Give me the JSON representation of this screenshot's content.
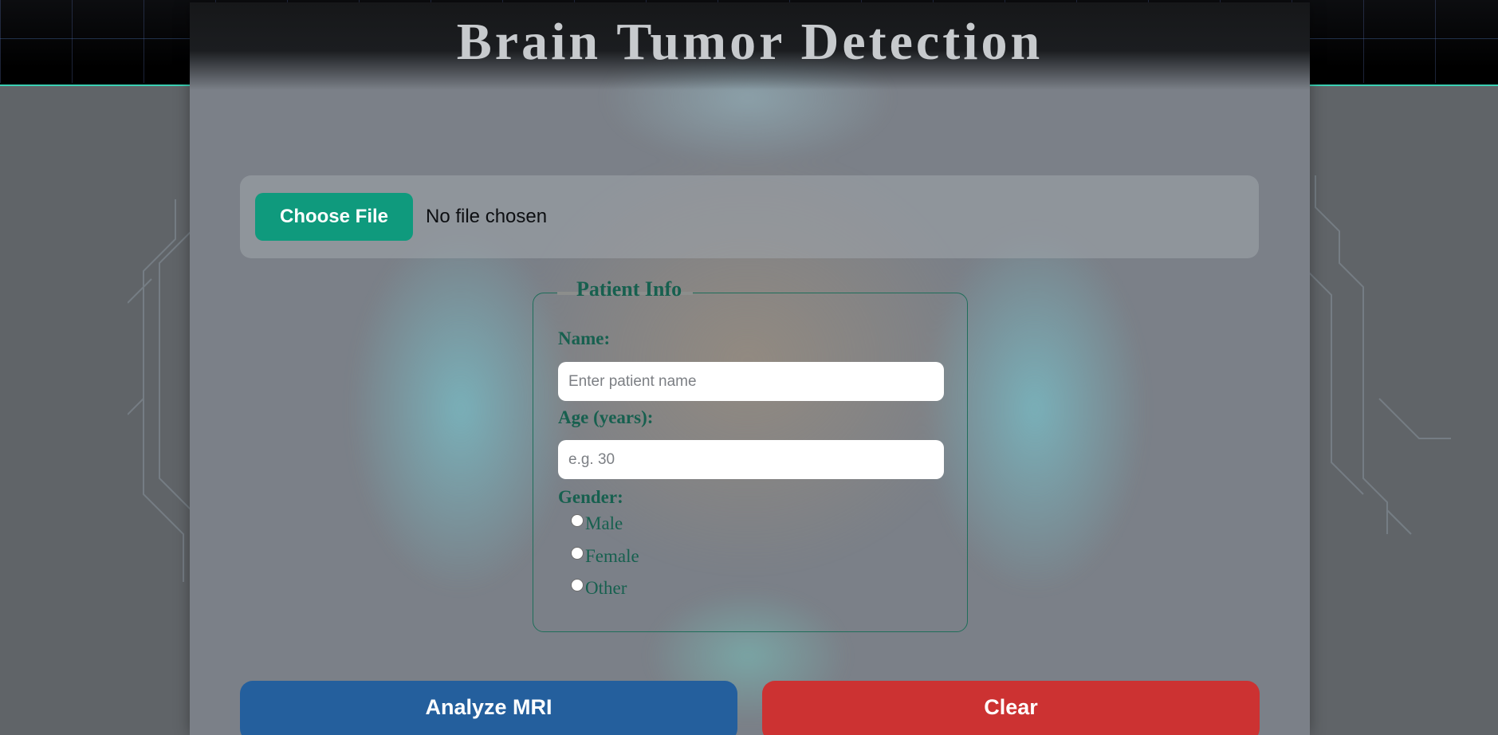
{
  "header": {
    "title": "Brain Tumor Detection"
  },
  "upload": {
    "button_label": "Choose File",
    "status_text": "No file chosen"
  },
  "patient_info": {
    "legend": "Patient Info",
    "name": {
      "label": "Name:",
      "value": "",
      "placeholder": "Enter patient name"
    },
    "age": {
      "label": "Age (years):",
      "value": "",
      "placeholder": "e.g. 30"
    },
    "gender": {
      "label": "Gender:",
      "options": [
        "Male",
        "Female",
        "Other"
      ],
      "selected": null
    }
  },
  "actions": {
    "analyze_label": "Analyze MRI",
    "clear_label": "Clear"
  },
  "colors": {
    "accent_green": "#0f9a7d",
    "label_green": "#17604f",
    "analyze_blue": "#245f9d",
    "clear_red": "#cc3232",
    "header_line": "#3bd1b4"
  }
}
